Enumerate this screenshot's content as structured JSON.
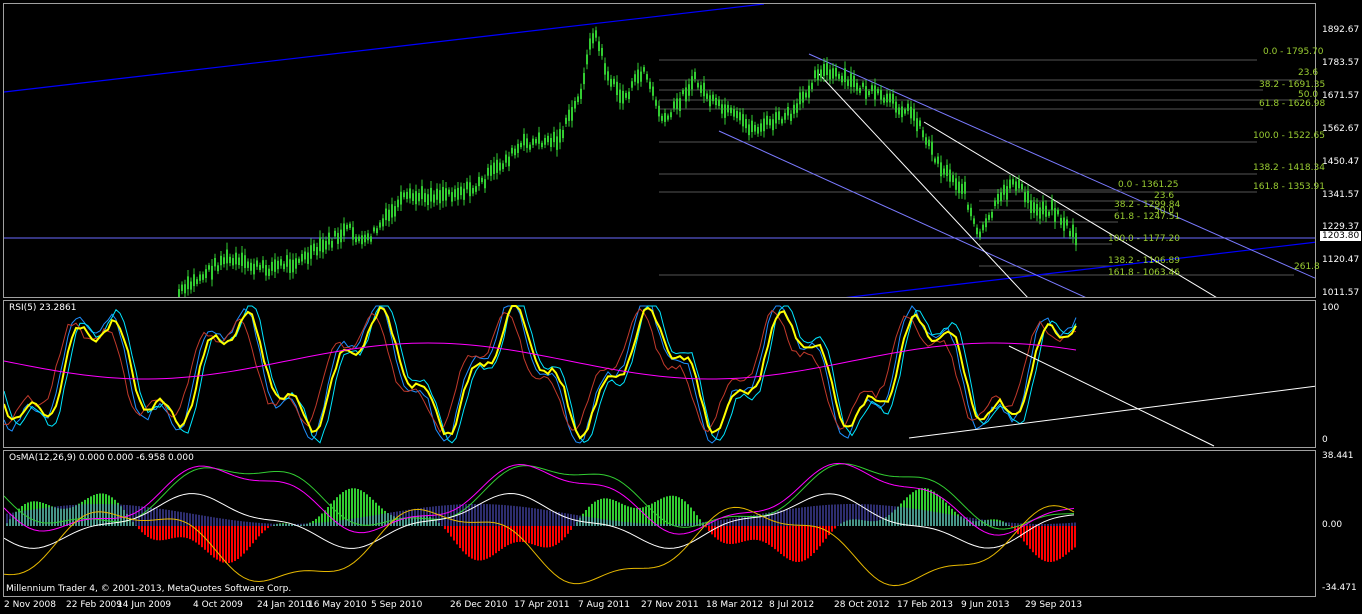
{
  "app": {
    "copyright": "Millennium Trader 4, © 2001-2013, MetaQuotes Software Corp."
  },
  "price_pane": {
    "scale_labels": [
      "1892.67",
      "1783.57",
      "1671.57",
      "1562.67",
      "1450.47",
      "1341.57",
      "1229.37",
      "1120.47",
      "1011.57"
    ],
    "current_price": "1203.80",
    "fib_left": [
      "0.0 - 1795.70",
      "23.6",
      "38.2 - 1691.35",
      "50.0",
      "61.8 - 1626.98",
      "100.0 - 1522.65",
      "138.2 - 1418.34",
      "161.8 - 1353.91"
    ],
    "fib_right": [
      "0.0 - 1361.25",
      "23.6",
      "38.2 - 1299.84",
      "50.0",
      "61.8 - 1247.51",
      "100.0 - 1177.20",
      "138.2 - 1106.89",
      "161.8 - 1063.46",
      "261.8"
    ]
  },
  "rsi_pane": {
    "label": "RSI(5) 23.2861",
    "scale_labels": [
      "100",
      "0"
    ]
  },
  "osma_pane": {
    "label": "OsMA(12,26,9) 0.000 0.000 -6.958 0.000",
    "scale_labels": [
      "38.441",
      "0.00",
      "-34.471"
    ]
  },
  "time_axis": [
    "2 Nov 2008",
    "22 Feb 2009",
    "14 Jun 2009",
    "4 Oct 2009",
    "24 Jan 2010",
    "16 May 2010",
    "5 Sep 2010",
    "26 Dec 2010",
    "17 Apr 2011",
    "7 Aug 2011",
    "27 Nov 2011",
    "18 Mar 2012",
    "8 Jul 2012",
    "28 Oct 2012",
    "17 Feb 2013",
    "9 Jun 2013",
    "29 Sep 2013"
  ],
  "colors": {
    "candles": "#32cd32",
    "trendline": "#0000ff",
    "fib": "#9acd32",
    "rsi_yellow": "#ffff00",
    "rsi_magenta": "#ff00ff",
    "osma_green": "#32cd32",
    "osma_red": "#ff0000"
  }
}
